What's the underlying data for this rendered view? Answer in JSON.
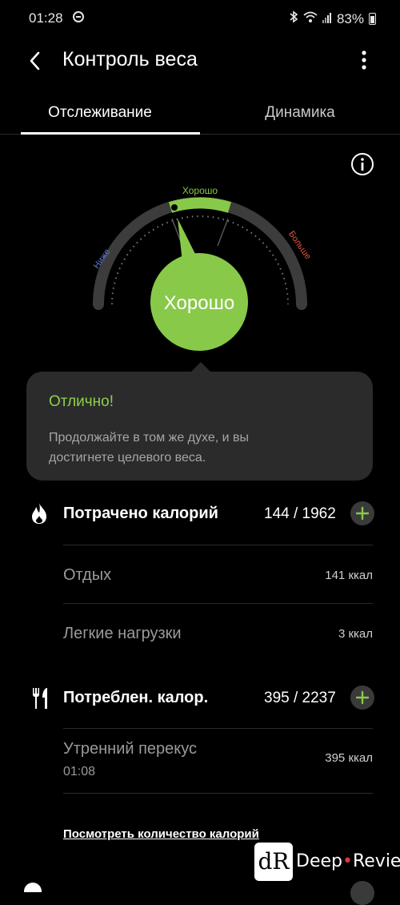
{
  "status_bar": {
    "time": "01:28",
    "battery": "83%"
  },
  "header": {
    "title": "Контроль веса"
  },
  "tabs": [
    {
      "label": "Отслеживание",
      "active": true
    },
    {
      "label": "Динамика",
      "active": false
    }
  ],
  "gauge": {
    "label_low": "Ниже",
    "label_good": "Хорошо",
    "label_high": "Больше",
    "status": "Хорошо",
    "colors": {
      "low": "#5b7bd5",
      "good": "#88c94a",
      "high": "#e0533f",
      "track": "#3c3c3c"
    }
  },
  "message": {
    "title": "Отлично!",
    "text": "Продолжайте в том же духе, и вы достигнете целевого веса."
  },
  "calories_burned": {
    "label": "Потрачено калорий",
    "value": "144 / 1962",
    "items": [
      {
        "label": "Отдых",
        "value": "141 ккал"
      },
      {
        "label": "Легкие нагрузки",
        "value": "3 ккал"
      }
    ]
  },
  "calories_consumed": {
    "label": "Потреблен. калор.",
    "value": "395 / 2237",
    "items": [
      {
        "label": "Утренний перекус",
        "time": "01:08",
        "value": "395 ккал"
      }
    ]
  },
  "link": {
    "view_calories": "Посмотреть количество калорий"
  },
  "watermark": {
    "logo": "dR",
    "name_left": "Deep",
    "name_right": "Review"
  }
}
